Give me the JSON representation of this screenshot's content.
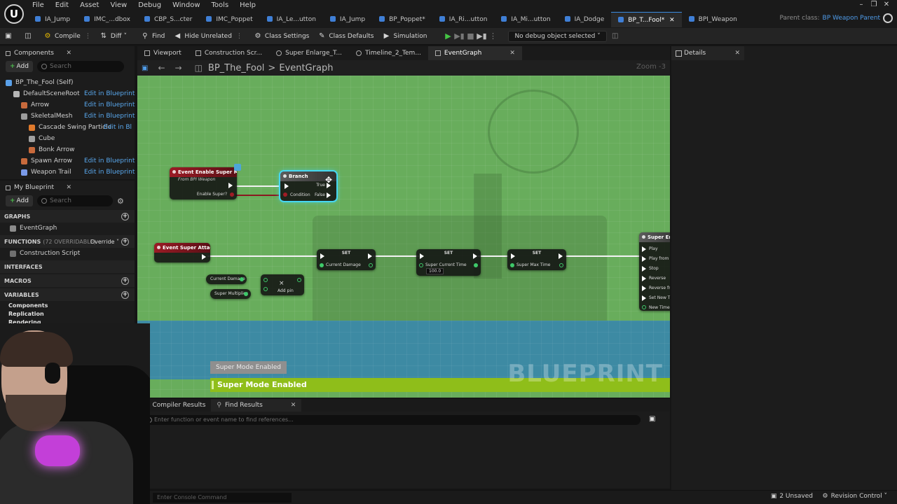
{
  "menu": [
    "File",
    "Edit",
    "Asset",
    "View",
    "Debug",
    "Window",
    "Tools",
    "Help"
  ],
  "doc_tabs": [
    {
      "label": "IA_Jump",
      "color": "#3f7fd6"
    },
    {
      "label": "IMC_...dbox",
      "color": "#3f7fd6"
    },
    {
      "label": "CBP_S...cter",
      "color": "#3f7fd6"
    },
    {
      "label": "IMC_Poppet",
      "color": "#3f7fd6"
    },
    {
      "label": "IA_Le...utton",
      "color": "#3f7fd6"
    },
    {
      "label": "IA_Jump",
      "color": "#3f7fd6"
    },
    {
      "label": "BP_Poppet*",
      "color": "#3f7fd6"
    },
    {
      "label": "IA_Ri...utton",
      "color": "#3f7fd6"
    },
    {
      "label": "IA_Mi...utton",
      "color": "#3f7fd6"
    },
    {
      "label": "IA_Dodge",
      "color": "#3f7fd6"
    },
    {
      "label": "BP_T...Fool*",
      "color": "#3f7fd6",
      "active": true
    },
    {
      "label": "BPI_Weapon",
      "color": "#3f7fd6"
    }
  ],
  "parent_class": {
    "label": "Parent class:",
    "value": "BP Weapon Parent"
  },
  "toolbar": {
    "compile": "Compile",
    "diff": "Diff",
    "find": "Find",
    "hide_unrelated": "Hide Unrelated",
    "class_settings": "Class Settings",
    "class_defaults": "Class Defaults",
    "simulation": "Simulation",
    "debug_object": "No debug object selected"
  },
  "components": {
    "tab": "Components",
    "add": "Add",
    "search_placeholder": "Search",
    "items": [
      {
        "label": "BP_The_Fool (Self)",
        "edit": "",
        "indent": 0
      },
      {
        "label": "DefaultSceneRoot",
        "edit": "Edit in Blueprint",
        "indent": 1
      },
      {
        "label": "Arrow",
        "edit": "Edit in Blueprint",
        "indent": 2
      },
      {
        "label": "SkeletalMesh",
        "edit": "Edit in Blueprint",
        "indent": 2
      },
      {
        "label": "Cascade Swing Particle",
        "edit": "Edit in Bl",
        "indent": 3
      },
      {
        "label": "Cube",
        "edit": "",
        "indent": 3
      },
      {
        "label": "Bonk Arrow",
        "edit": "",
        "indent": 3
      },
      {
        "label": "Spawn Arrow",
        "edit": "Edit in Blueprint",
        "indent": 2
      },
      {
        "label": "Weapon Trail",
        "edit": "Edit in Blueprint",
        "indent": 2
      }
    ]
  },
  "my_blueprint": {
    "tab": "My Blueprint",
    "add": "Add",
    "search_placeholder": "Search",
    "graphs_hdr": "GRAPHS",
    "graphs": [
      "EventGraph"
    ],
    "functions_hdr": "FUNCTIONS",
    "functions_count": "(72 OVERRIDABLE)",
    "override": "Override",
    "functions": [
      "Construction Script"
    ],
    "interfaces_hdr": "INTERFACES",
    "macros_hdr": "MACROS",
    "variables_hdr": "VARIABLES",
    "variable_groups": [
      "Components",
      "Replication",
      "Rendering"
    ]
  },
  "graph_tabs": [
    "Viewport",
    "Construction Scr...",
    "Super Enlarge_T...",
    "Timeline_2_Tem...",
    "EventGraph"
  ],
  "breadcrumb": {
    "bp": "BP_The_Fool",
    "sep": ">",
    "graph": "EventGraph"
  },
  "zoom": "Zoom -3",
  "nodes": {
    "enable_super": {
      "title": "Event Enable Super Mode",
      "sub": "From BPI Weapon",
      "pin": "Enable Super?"
    },
    "branch": {
      "title": "Branch",
      "condition": "Condition",
      "true": "True",
      "false": "False"
    },
    "super_attack": {
      "title": "Event Super Attack"
    },
    "set1": {
      "title": "SET",
      "pin": "Current Damage"
    },
    "set2": {
      "title": "SET",
      "pin": "Super Current Time",
      "value": "100.0"
    },
    "set3": {
      "title": "SET",
      "pin": "Super Max Time"
    },
    "getter1": "Current Damage",
    "getter2": "Super Multiplier",
    "multiply": {
      "symbol": "×",
      "add_pin": "Add pin"
    },
    "timeline": {
      "title": "Super Enlar",
      "pins": [
        "Play",
        "Play from St",
        "Stop",
        "Reverse",
        "Reverse from",
        "Set New Tim",
        "New Time"
      ]
    }
  },
  "toast_small": "Super Mode Enabled",
  "toast_big": "Super Mode Enabled",
  "watermark": "BLUEPRINT",
  "details": {
    "tab": "Details"
  },
  "bottom_tabs": [
    "Compiler Results",
    "Find Results"
  ],
  "find_placeholder": "Enter function or event name to find references...",
  "console_placeholder": "Enter Console Command",
  "status": {
    "unsaved": "2 Unsaved",
    "revision": "Revision Control"
  }
}
